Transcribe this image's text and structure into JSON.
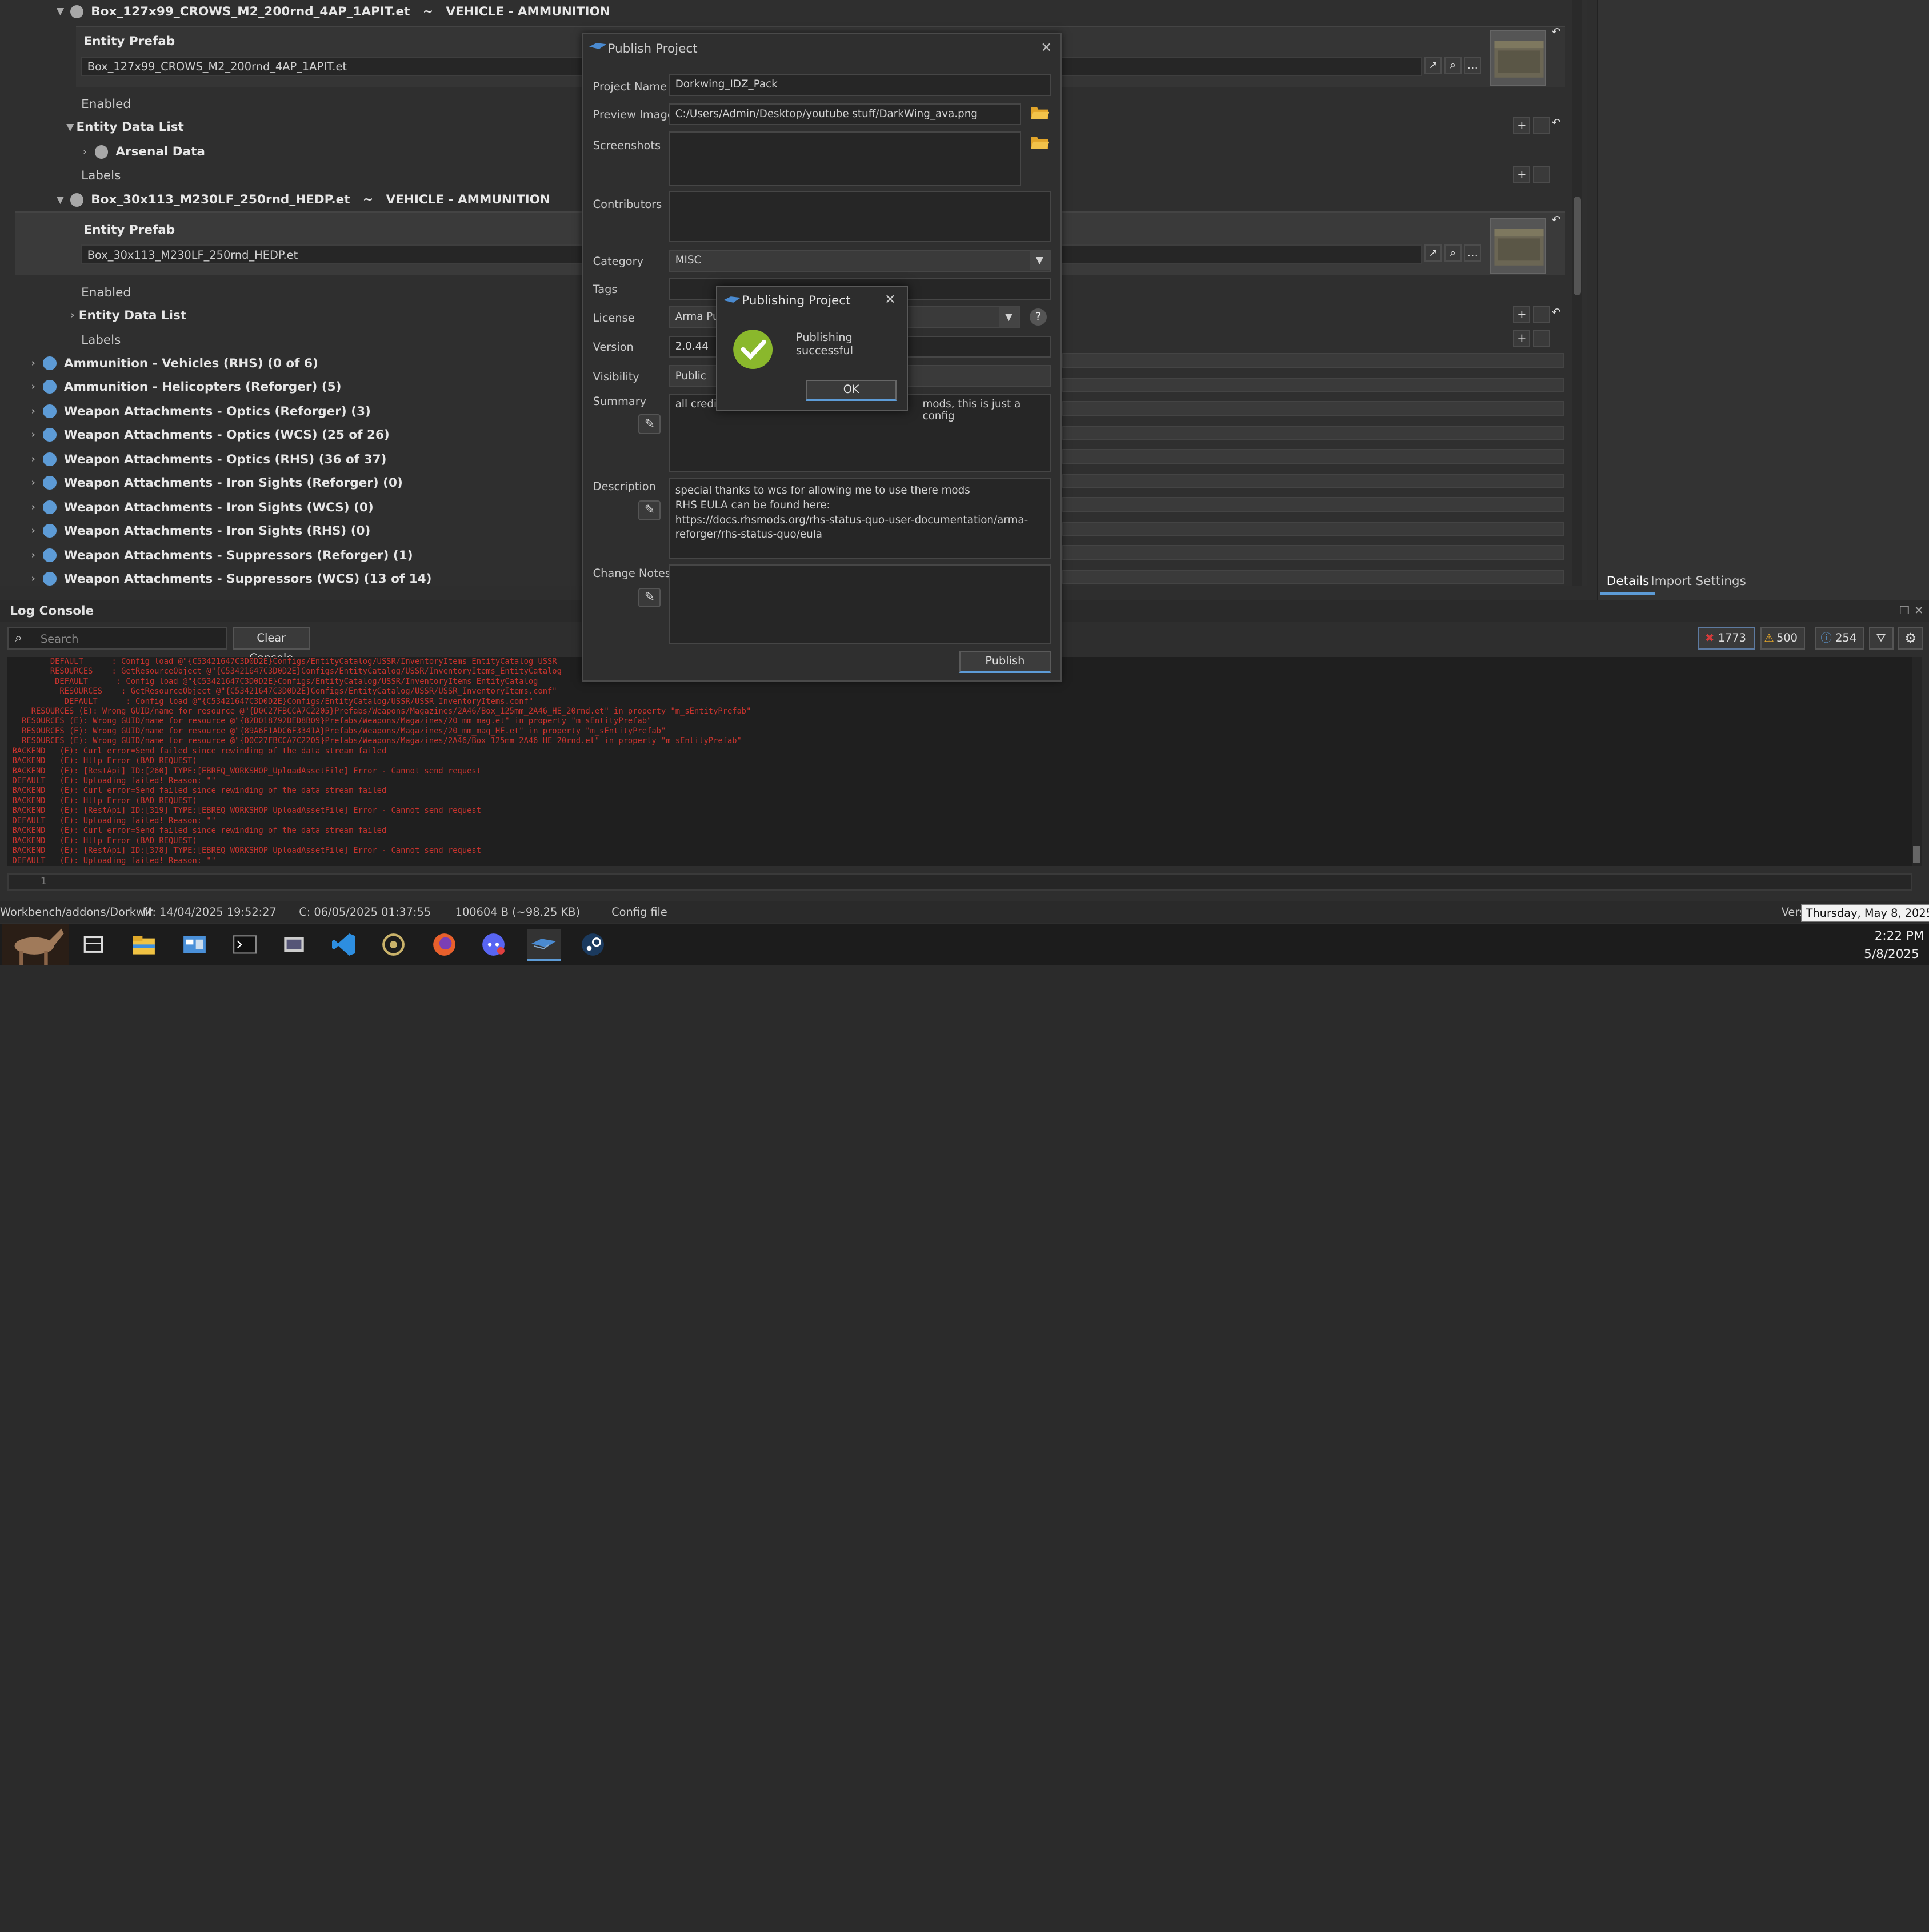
{
  "tree": {
    "box1": {
      "name": "Box_127x99_CROWS_M2_200rnd_4AP_1APIT.et",
      "sep": "~",
      "type": "VEHICLE - AMMUNITION",
      "prefab_label": "Entity Prefab",
      "prefab_value": "Box_127x99_CROWS_M2_200rnd_4AP_1APIT.et"
    },
    "enabled1": "Enabled",
    "entity_data_list1": "Entity Data List",
    "arsenal_data": "Arsenal Data",
    "labels1": "Labels",
    "box2": {
      "name": "Box_30x113_M230LF_250rnd_HEDP.et",
      "sep": "~",
      "type": "VEHICLE - AMMUNITION",
      "prefab_label": "Entity Prefab",
      "prefab_value": "Box_30x113_M230LF_250rnd_HEDP.et"
    },
    "enabled2": "Enabled",
    "entity_data_list2": "Entity Data List",
    "labels2": "Labels",
    "groups": [
      "Ammunition - Vehicles (RHS) (0 of 6)",
      "Ammunition - Helicopters (Reforger) (5)",
      "Weapon Attachments - Optics (Reforger) (3)",
      "Weapon Attachments - Optics (WCS) (25 of 26)",
      "Weapon Attachments - Optics (RHS) (36 of 37)",
      "Weapon Attachments - Iron Sights (Reforger) (0)",
      "Weapon Attachments - Iron Sights (WCS) (0)",
      "Weapon Attachments - Iron Sights (RHS) (0)",
      "Weapon Attachments - Suppressors (Reforger) (1)",
      "Weapon Attachments - Suppressors (WCS) (13 of 14)"
    ]
  },
  "right_panel": {
    "tabs": [
      "Details",
      "Import Settings"
    ]
  },
  "publish_dialog": {
    "title": "Publish Project",
    "project_name_label": "Project Name",
    "project_name": "Dorkwing_IDZ_Pack",
    "preview_image_label": "Preview Image",
    "preview_image": "C:/Users/Admin/Desktop/youtube stuff/DarkWing_ava.png",
    "screenshots_label": "Screenshots",
    "contributors_label": "Contributors",
    "category_label": "Category",
    "category": "MISC",
    "tags_label": "Tags",
    "license_label": "License",
    "license": "Arma Pu",
    "version_label": "Version",
    "version": "2.0.44",
    "visibility_label": "Visibility",
    "visibility": "Public",
    "summary_label": "Summary",
    "summary_left": "all credit",
    "summary_right": "mods, this is just a config",
    "description_label": "Description",
    "description_lines": [
      "special thanks to wcs for allowing me to use there mods",
      "RHS EULA can be found here:",
      "https://docs.rhsmods.org/rhs-status-quo-user-documentation/arma-",
      "reforger/rhs-status-quo/eula"
    ],
    "change_notes_label": "Change Notes",
    "publish_button": "Publish"
  },
  "publishing_dialog": {
    "title": "Publishing Project",
    "message": "Publishing successful",
    "ok_button": "OK"
  },
  "log_console": {
    "title": "Log Console",
    "search_placeholder": "Search",
    "clear_button": "Clear Console",
    "error_count": "1773",
    "warning_count": "500",
    "info_count": "254",
    "line_number": "1",
    "lines": [
      "        DEFAULT      : Config load @\"{C53421647C3D0D2E}Configs/EntityCatalog/USSR/InventoryItems_EntityCatalog_USSR",
      "        RESOURCES    : GetResourceObject @\"{C53421647C3D0D2E}Configs/EntityCatalog/USSR/InventoryItems_EntityCatalog",
      "         DEFAULT      : Config load @\"{C53421647C3D0D2E}Configs/EntityCatalog/USSR/InventoryItems_EntityCatalog_",
      "          RESOURCES    : GetResourceObject @\"{C53421647C3D0D2E}Configs/EntityCatalog/USSR/USSR_InventoryItems.conf\"",
      "           DEFAULT      : Config load @\"{C53421647C3D0D2E}Configs/EntityCatalog/USSR/USSR_InventoryItems.conf\"",
      "    RESOURCES (E): Wrong GUID/name for resource @\"{D0C27FBCCA7C2205}Prefabs/Weapons/Magazines/2A46/Box_125mm_2A46_HE_20rnd.et\" in property \"m_sEntityPrefab\"",
      "  RESOURCES (E): Wrong GUID/name for resource @\"{82D018792DED8B09}Prefabs/Weapons/Magazines/20_mm_mag.et\" in property \"m_sEntityPrefab\"",
      "  RESOURCES (E): Wrong GUID/name for resource @\"{89A6F1ADC6F3341A}Prefabs/Weapons/Magazines/20_mm_mag_HE.et\" in property \"m_sEntityPrefab\"",
      "  RESOURCES (E): Wrong GUID/name for resource @\"{D0C27FBCCA7C2205}Prefabs/Weapons/Magazines/2A46/Box_125mm_2A46_HE_20rnd.et\" in property \"m_sEntityPrefab\"",
      "BACKEND   (E): Curl error=Send failed since rewinding of the data stream failed",
      "BACKEND   (E): Http Error (BAD_REQUEST)",
      "BACKEND   (E): [RestApi] ID:[260] TYPE:[EBREQ_WORKSHOP_UploadAssetFile] Error - Cannot send request",
      "DEFAULT   (E): Uploading failed! Reason: \"\"",
      "BACKEND   (E): Curl error=Send failed since rewinding of the data stream failed",
      "BACKEND   (E): Http Error (BAD_REQUEST)",
      "BACKEND   (E): [RestApi] ID:[319] TYPE:[EBREQ_WORKSHOP_UploadAssetFile] Error - Cannot send request",
      "DEFAULT   (E): Uploading failed! Reason: \"\"",
      "BACKEND   (E): Curl error=Send failed since rewinding of the data stream failed",
      "BACKEND   (E): Http Error (BAD_REQUEST)",
      "BACKEND   (E): [RestApi] ID:[378] TYPE:[EBREQ_WORKSHOP_UploadAssetFile] Error - Cannot send request",
      "DEFAULT   (E): Uploading failed! Reason: \"\""
    ]
  },
  "status_bar": {
    "path": "Workbench/addons/Dorkwir",
    "modified": "M: 14/04/2025 19:52:27",
    "created": "C: 06/05/2025 01:37:55",
    "size": "100604 B (~98.25 KB)",
    "type": "Config file",
    "version": "Vers",
    "tooltip": "Thursday, May 8, 2025"
  },
  "taskbar": {
    "time": "2:22 PM",
    "date": "5/8/2025"
  },
  "colors": {
    "error": "#c8342e",
    "accent_blue": "#5d9bd6",
    "success_green": "#8ab82c"
  }
}
